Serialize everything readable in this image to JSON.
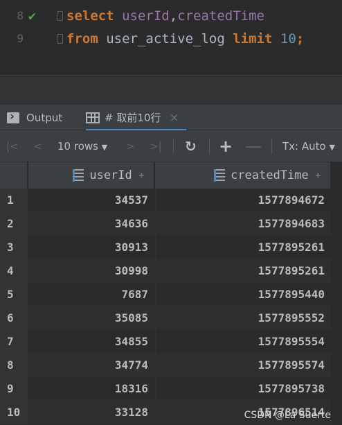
{
  "editor": {
    "lines": [
      {
        "number": "8",
        "status": "check",
        "tokens": [
          {
            "text": "select ",
            "kind": "kw"
          },
          {
            "text": "userId",
            "kind": "id"
          },
          {
            "text": ",",
            "kind": "plain"
          },
          {
            "text": "createdTime",
            "kind": "id"
          }
        ]
      },
      {
        "number": "9",
        "status": "",
        "tokens": [
          {
            "text": "from ",
            "kind": "kw"
          },
          {
            "text": "user_active_log ",
            "kind": "plain"
          },
          {
            "text": "limit ",
            "kind": "kw"
          },
          {
            "text": "10",
            "kind": "num"
          },
          {
            "text": ";",
            "kind": "kw"
          }
        ]
      }
    ]
  },
  "tabs": {
    "output_label": "Output",
    "result_label": "# 取前10行",
    "close_glyph": "×"
  },
  "toolbar": {
    "first_glyph": "|<",
    "prev_glyph": "<",
    "page_size_label": "10 rows",
    "next_glyph": ">",
    "last_glyph": ">|",
    "refresh_glyph": "↻",
    "add_glyph": "+",
    "remove_glyph": "—",
    "tx_label": "Tx: Auto"
  },
  "grid": {
    "columns": [
      "userId",
      "createdTime"
    ],
    "sort_glyph": "÷",
    "rows": [
      {
        "n": "1",
        "userId": "34537",
        "createdTime": "1577894672"
      },
      {
        "n": "2",
        "userId": "34636",
        "createdTime": "1577894683"
      },
      {
        "n": "3",
        "userId": "30913",
        "createdTime": "1577895261"
      },
      {
        "n": "4",
        "userId": "30998",
        "createdTime": "1577895261"
      },
      {
        "n": "5",
        "userId": "7687",
        "createdTime": "1577895440"
      },
      {
        "n": "6",
        "userId": "35085",
        "createdTime": "1577895552"
      },
      {
        "n": "7",
        "userId": "34855",
        "createdTime": "1577895554"
      },
      {
        "n": "8",
        "userId": "34774",
        "createdTime": "1577895574"
      },
      {
        "n": "9",
        "userId": "18316",
        "createdTime": "1577895738"
      },
      {
        "n": "10",
        "userId": "33128",
        "createdTime": "1577896514"
      }
    ]
  },
  "watermark": "CSDN @La Suerte",
  "colors": {
    "keyword": "#cc7832",
    "identifier": "#9876aa",
    "number": "#6897bb",
    "accent": "#4a88c7",
    "success": "#4fa84a"
  },
  "icons": [
    "check-icon",
    "fold-icon",
    "output-icon",
    "grid-icon",
    "close-icon",
    "column-icon",
    "sort-icon",
    "refresh-icon",
    "chevron-down-icon"
  ]
}
